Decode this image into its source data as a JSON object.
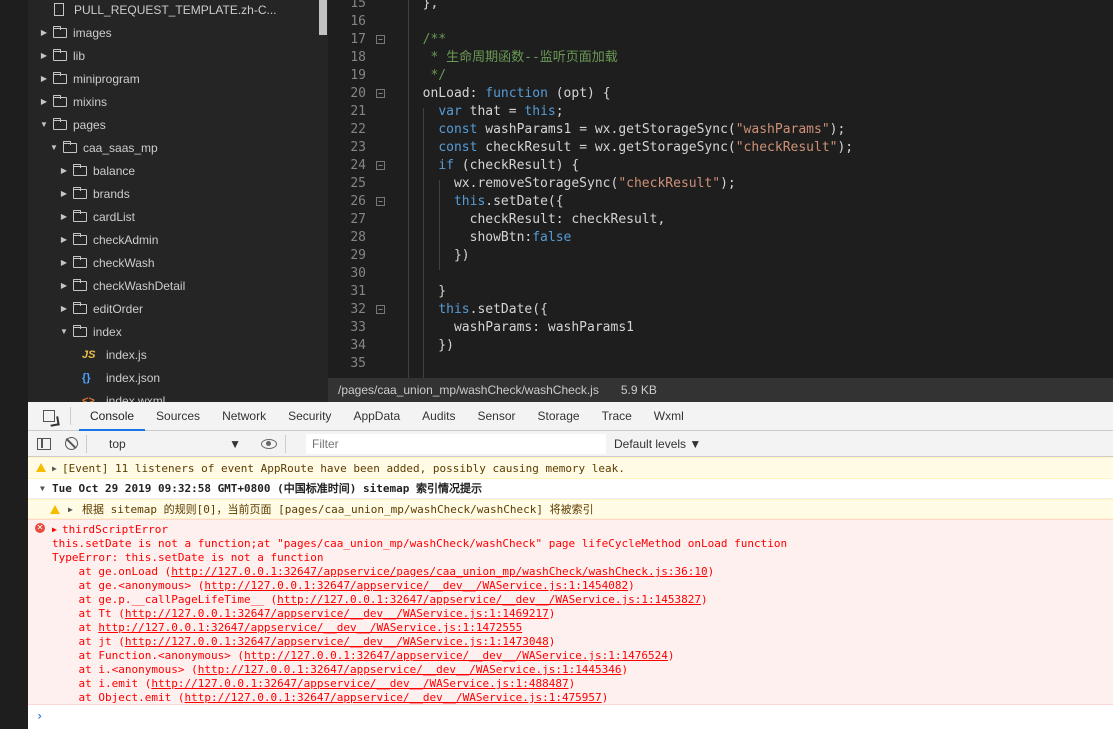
{
  "file_tree": {
    "items": [
      {
        "label": "PULL_REQUEST_TEMPLATE.zh-C...",
        "type": "file",
        "depth": 0
      },
      {
        "label": "images",
        "type": "folder",
        "expanded": false,
        "depth": 0
      },
      {
        "label": "lib",
        "type": "folder",
        "expanded": false,
        "depth": 0
      },
      {
        "label": "miniprogram",
        "type": "folder",
        "expanded": false,
        "depth": 0
      },
      {
        "label": "mixins",
        "type": "folder",
        "expanded": false,
        "depth": 0
      },
      {
        "label": "pages",
        "type": "folder",
        "expanded": true,
        "depth": 0
      },
      {
        "label": "caa_saas_mp",
        "type": "folder",
        "expanded": true,
        "depth": 1
      },
      {
        "label": "balance",
        "type": "folder",
        "expanded": false,
        "depth": 2
      },
      {
        "label": "brands",
        "type": "folder",
        "expanded": false,
        "depth": 2
      },
      {
        "label": "cardList",
        "type": "folder",
        "expanded": false,
        "depth": 2
      },
      {
        "label": "checkAdmin",
        "type": "folder",
        "expanded": false,
        "depth": 2
      },
      {
        "label": "checkWash",
        "type": "folder",
        "expanded": false,
        "depth": 2
      },
      {
        "label": "checkWashDetail",
        "type": "folder",
        "expanded": false,
        "depth": 2
      },
      {
        "label": "editOrder",
        "type": "folder",
        "expanded": false,
        "depth": 2
      },
      {
        "label": "index",
        "type": "folder",
        "expanded": true,
        "depth": 2
      },
      {
        "label": "index.js",
        "type": "js",
        "icon_text": "JS",
        "depth": 3
      },
      {
        "label": "index.json",
        "type": "json",
        "icon_text": "{}",
        "depth": 3
      },
      {
        "label": "index.wxml",
        "type": "wxml",
        "icon_text": "<>",
        "depth": 3
      }
    ]
  },
  "editor": {
    "lines": [
      {
        "n": "15",
        "fold": false,
        "html": "  },"
      },
      {
        "n": "16",
        "fold": false,
        "html": ""
      },
      {
        "n": "17",
        "fold": true,
        "html": "  <span class=\"cm\">/**</span>"
      },
      {
        "n": "18",
        "fold": false,
        "html": "<span class=\"cm\">   * 生命周期函数--监听页面加载</span>"
      },
      {
        "n": "19",
        "fold": false,
        "html": "<span class=\"cm\">   */</span>"
      },
      {
        "n": "20",
        "fold": true,
        "html": "  onLoad: <span class=\"kw\">function</span> (opt) {"
      },
      {
        "n": "21",
        "fold": false,
        "html": "    <span class=\"kw\">var</span> that = <span class=\"kw\">this</span>;"
      },
      {
        "n": "22",
        "fold": false,
        "html": "    <span class=\"kw\">const</span> washParams1 = wx.getStorageSync(<span class=\"str\">\"washParams\"</span>);"
      },
      {
        "n": "23",
        "fold": false,
        "html": "    <span class=\"kw\">const</span> checkResult = wx.getStorageSync(<span class=\"str\">\"checkResult\"</span>);"
      },
      {
        "n": "24",
        "fold": true,
        "html": "    <span class=\"kw\">if</span> (checkResult) {"
      },
      {
        "n": "25",
        "fold": false,
        "html": "      wx.removeStorageSync(<span class=\"str\">\"checkResult\"</span>);"
      },
      {
        "n": "26",
        "fold": true,
        "html": "      <span class=\"kw\">this</span>.setDate({"
      },
      {
        "n": "27",
        "fold": false,
        "html": "        checkResult: checkResult,"
      },
      {
        "n": "28",
        "fold": false,
        "html": "        showBtn:<span class=\"kw\">false</span>"
      },
      {
        "n": "29",
        "fold": false,
        "html": "      })"
      },
      {
        "n": "30",
        "fold": false,
        "html": ""
      },
      {
        "n": "31",
        "fold": false,
        "html": "    }"
      },
      {
        "n": "32",
        "fold": true,
        "html": "    <span class=\"kw\">this</span>.setDate({"
      },
      {
        "n": "33",
        "fold": false,
        "html": "      washParams: washParams1"
      },
      {
        "n": "34",
        "fold": false,
        "html": "    })"
      },
      {
        "n": "35",
        "fold": false,
        "html": ""
      }
    ]
  },
  "statusbar": {
    "path": "/pages/caa_union_mp/washCheck/washCheck.js",
    "size": "5.9 KB"
  },
  "devtools": {
    "tabs": [
      {
        "label": "Console",
        "active": true
      },
      {
        "label": "Sources",
        "active": false
      },
      {
        "label": "Network",
        "active": false
      },
      {
        "label": "Security",
        "active": false
      },
      {
        "label": "AppData",
        "active": false
      },
      {
        "label": "Audits",
        "active": false
      },
      {
        "label": "Sensor",
        "active": false
      },
      {
        "label": "Storage",
        "active": false
      },
      {
        "label": "Trace",
        "active": false
      },
      {
        "label": "Wxml",
        "active": false
      }
    ],
    "toolbar": {
      "context": "top",
      "filter_placeholder": "Filter",
      "levels": "Default levels ▼"
    }
  },
  "console": {
    "warning1": "[Event] 11 listeners of event AppRoute have been added, possibly causing memory leak.",
    "group_title": "Tue Oct 29 2019 09:32:58 GMT+0800 (中国标准时间) sitemap 索引情况提示",
    "warning2": "根据 sitemap 的规则[0]，当前页面 [pages/caa_union_mp/washCheck/washCheck] 将被索引",
    "error_title": "thirdScriptError",
    "error_lines": [
      "this.setDate is not a function;at \"pages/caa_union_mp/washCheck/washCheck\" page lifeCycleMethod onLoad function",
      "TypeError: this.setDate is not a function"
    ],
    "stack": [
      {
        "prefix": "    at ge.onLoad (",
        "link": "http://127.0.0.1:32647/appservice/pages/caa_union_mp/washCheck/washCheck.js:36:10",
        "suffix": ")"
      },
      {
        "prefix": "    at ge.<anonymous> (",
        "link": "http://127.0.0.1:32647/appservice/__dev__/WAService.js:1:1454082",
        "suffix": ")"
      },
      {
        "prefix": "    at ge.p.__callPageLifeTime__ (",
        "link": "http://127.0.0.1:32647/appservice/__dev__/WAService.js:1:1453827",
        "suffix": ")"
      },
      {
        "prefix": "    at Tt (",
        "link": "http://127.0.0.1:32647/appservice/__dev__/WAService.js:1:1469217",
        "suffix": ")"
      },
      {
        "prefix": "    at ",
        "link": "http://127.0.0.1:32647/appservice/__dev__/WAService.js:1:1472555",
        "suffix": ""
      },
      {
        "prefix": "    at jt (",
        "link": "http://127.0.0.1:32647/appservice/__dev__/WAService.js:1:1473048",
        "suffix": ")"
      },
      {
        "prefix": "    at Function.<anonymous> (",
        "link": "http://127.0.0.1:32647/appservice/__dev__/WAService.js:1:1476524",
        "suffix": ")"
      },
      {
        "prefix": "    at i.<anonymous> (",
        "link": "http://127.0.0.1:32647/appservice/__dev__/WAService.js:1:1445346",
        "suffix": ")"
      },
      {
        "prefix": "    at i.emit (",
        "link": "http://127.0.0.1:32647/appservice/__dev__/WAService.js:1:488487",
        "suffix": ")"
      },
      {
        "prefix": "    at Object.emit (",
        "link": "http://127.0.0.1:32647/appservice/__dev__/WAService.js:1:475957",
        "suffix": ")"
      }
    ],
    "prompt": "›"
  }
}
